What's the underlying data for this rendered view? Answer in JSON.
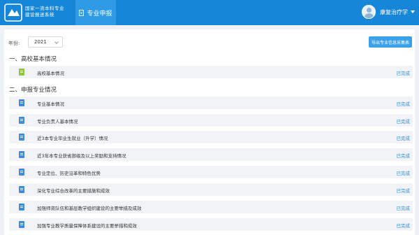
{
  "header": {
    "brand_line1": "国家一流本科专业",
    "brand_line2": "建设报送系统",
    "nav_tab_label": "专业申报",
    "user_name": "康复治疗学"
  },
  "filter": {
    "year_label": "年份:",
    "year_value": "2021",
    "export_label": "导出专业信息采集表"
  },
  "sections": [
    {
      "title": "一、高校基本情况",
      "items": [
        {
          "label": "高校基本情况",
          "status": "已完成",
          "icon": "green-doc-icon"
        }
      ]
    },
    {
      "title": "二、申报专业情况",
      "items": [
        {
          "label": "专业基本情况",
          "status": "已完成",
          "icon": "blue-doc-icon"
        },
        {
          "label": "专业负责人基本情况",
          "status": "已完成",
          "icon": "blue-doc-icon"
        },
        {
          "label": "近3本专业毕业生就业（升学）情况",
          "status": "已完成",
          "icon": "blue-doc-icon"
        },
        {
          "label": "近3年本专业获省部级及以上奖励和支持情况",
          "status": "已完成",
          "icon": "blue-doc-icon"
        },
        {
          "label": "专业定位、历史沿革和特色优势",
          "status": "已完成",
          "icon": "blue-doc-icon"
        },
        {
          "label": "深化专业综合改革的主要措施和成效",
          "status": "已完成",
          "icon": "blue-doc-icon"
        },
        {
          "label": "加强师资队伍和基层教学组织建设的主要举措及成效",
          "status": "已完成",
          "icon": "blue-doc-icon"
        },
        {
          "label": "加强专业教学质量保障体系建设的主要举措和成效",
          "status": "已完成",
          "icon": "blue-doc-icon"
        }
      ]
    }
  ],
  "colors": {
    "header_bg": "#1686d8",
    "accent": "#2b8fe0",
    "row_bg": "#f1f3f6"
  }
}
